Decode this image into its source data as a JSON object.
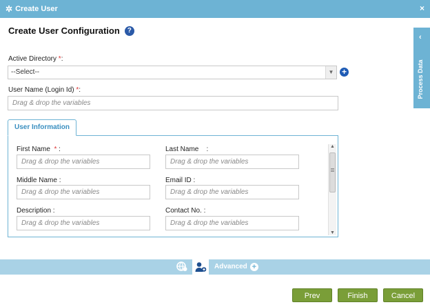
{
  "window": {
    "title": "Create User",
    "close_glyph": "×",
    "gear_icon": "gear-icon"
  },
  "heading": {
    "title": "Create User Configuration",
    "help_glyph": "?"
  },
  "active_directory": {
    "label": "Active Directory",
    "required": "*",
    "colon": ":",
    "value": "--Select--"
  },
  "user_name": {
    "label": "User Name (Login Id)",
    "required": "*",
    "colon": ":",
    "placeholder": "Drag & drop the variables"
  },
  "side_panel": {
    "label": "Process Data"
  },
  "tab": {
    "label": "User Information"
  },
  "fields": {
    "first_name": {
      "label": "First Name",
      "required": "*",
      "colon": ":",
      "placeholder": "Drag & drop the variables"
    },
    "last_name": {
      "label": "Last Name",
      "colon": ":",
      "placeholder": "Drag & drop the variables"
    },
    "middle_name": {
      "label": "Middle Name :",
      "placeholder": "Drag & drop the variables"
    },
    "email_id": {
      "label": "Email ID :",
      "placeholder": "Drag & drop the variables"
    },
    "description": {
      "label": "Description :",
      "placeholder": "Drag & drop the variables"
    },
    "contact_no": {
      "label": "Contact No. :",
      "placeholder": "Drag & drop the variables"
    }
  },
  "bottom_bar": {
    "advanced_label": "Advanced"
  },
  "buttons": {
    "prev": "Prev",
    "finish": "Finish",
    "cancel": "Cancel"
  },
  "colors": {
    "accent": "#6db3d4",
    "button_green": "#7a9e38",
    "required_red": "#dd3333"
  }
}
